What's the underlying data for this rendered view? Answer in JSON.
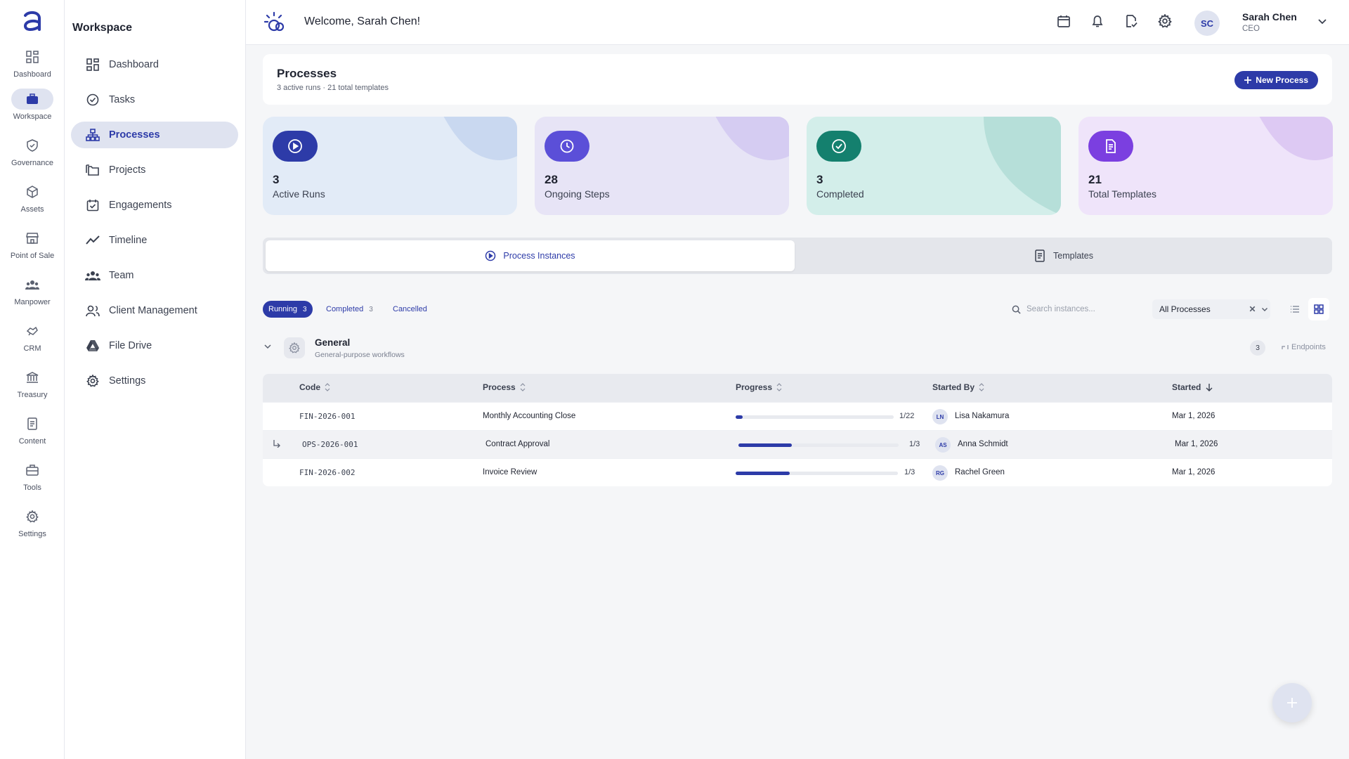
{
  "rail": {
    "items": [
      {
        "label": "Dashboard",
        "icon": "dashboard-icon"
      },
      {
        "label": "Workspace",
        "icon": "briefcase-icon",
        "active": true
      },
      {
        "label": "Governance",
        "icon": "shield-icon"
      },
      {
        "label": "Assets",
        "icon": "cube-icon"
      },
      {
        "label": "Point of Sale",
        "icon": "store-icon"
      },
      {
        "label": "Manpower",
        "icon": "people-icon"
      },
      {
        "label": "CRM",
        "icon": "handshake-icon"
      },
      {
        "label": "Treasury",
        "icon": "bank-icon"
      },
      {
        "label": "Content",
        "icon": "document-icon"
      },
      {
        "label": "Tools",
        "icon": "toolbox-icon"
      },
      {
        "label": "Settings",
        "icon": "gear-icon"
      }
    ]
  },
  "sidebar": {
    "title": "Workspace",
    "items": [
      {
        "label": "Dashboard",
        "icon": "grid-icon"
      },
      {
        "label": "Tasks",
        "icon": "check-circle-icon"
      },
      {
        "label": "Processes",
        "icon": "hierarchy-icon",
        "active": true
      },
      {
        "label": "Projects",
        "icon": "folders-icon"
      },
      {
        "label": "Engagements",
        "icon": "calendar-check-icon"
      },
      {
        "label": "Timeline",
        "icon": "trend-line-icon"
      },
      {
        "label": "Team",
        "icon": "team-icon"
      },
      {
        "label": "Client Management",
        "icon": "client-icon"
      },
      {
        "label": "File Drive",
        "icon": "drive-icon"
      },
      {
        "label": "Settings",
        "icon": "gear-icon"
      }
    ]
  },
  "header": {
    "welcome": "Welcome, Sarah Chen!",
    "user": {
      "initials": "SC",
      "name": "Sarah Chen",
      "role": "CEO"
    }
  },
  "page": {
    "title": "Processes",
    "subtitle": "3 active runs · 21 total templates",
    "new_button": "New Process"
  },
  "stats": [
    {
      "value": "3",
      "label": "Active Runs",
      "bg": "#e2ebf7",
      "blob": "#c9d8f0",
      "icon_bg": "#2d3ba8",
      "icon": "play-circle-icon"
    },
    {
      "value": "28",
      "label": "Ongoing Steps",
      "bg": "#e7e4f6",
      "blob": "#d5ccf2",
      "icon_bg": "#5b4fd8",
      "icon": "clock-icon"
    },
    {
      "value": "3",
      "label": "Completed",
      "bg": "#d3eeea",
      "blob": "#b6dfd9",
      "icon_bg": "#14806e",
      "icon": "check-circle-icon"
    },
    {
      "value": "21",
      "label": "Total Templates",
      "bg": "#efe4fa",
      "blob": "#ddc9f3",
      "icon_bg": "#7b3fe0",
      "icon": "document-icon"
    }
  ],
  "tabs": [
    {
      "label": "Process Instances",
      "icon": "play-circle-icon",
      "active": true
    },
    {
      "label": "Templates",
      "icon": "document-icon",
      "active": false
    }
  ],
  "filters": {
    "pills": [
      {
        "label": "Running",
        "count": "3",
        "active": true
      },
      {
        "label": "Completed",
        "count": "3",
        "active": false
      },
      {
        "label": "Cancelled",
        "count": "",
        "active": false
      }
    ],
    "search_placeholder": "Search instances...",
    "select_value": "All Processes"
  },
  "group": {
    "name": "General",
    "description": "General-purpose workflows",
    "count": "3",
    "endpoints_label": "Endpoints"
  },
  "table": {
    "headers": {
      "code": "Code",
      "process": "Process",
      "progress": "Progress",
      "started_by": "Started By",
      "started": "Started"
    },
    "rows": [
      {
        "code": "FIN-2026-001",
        "process": "Monthly Accounting Close",
        "progress_fraction": 0.045,
        "progress_text": "1/22",
        "initials": "LN",
        "started_by": "Lisa Nakamura",
        "started": "Mar 1, 2026",
        "sub": false
      },
      {
        "code": "OPS-2026-001",
        "process": "Contract Approval",
        "progress_fraction": 0.333,
        "progress_text": "1/3",
        "initials": "AS",
        "started_by": "Anna Schmidt",
        "started": "Mar 1, 2026",
        "sub": true
      },
      {
        "code": "FIN-2026-002",
        "process": "Invoice Review",
        "progress_fraction": 0.333,
        "progress_text": "1/3",
        "initials": "RG",
        "started_by": "Rachel Green",
        "started": "Mar 1, 2026",
        "sub": false
      }
    ]
  },
  "colors": {
    "accent": "#2d3ba8",
    "accent_light": "#dfe3f0"
  }
}
